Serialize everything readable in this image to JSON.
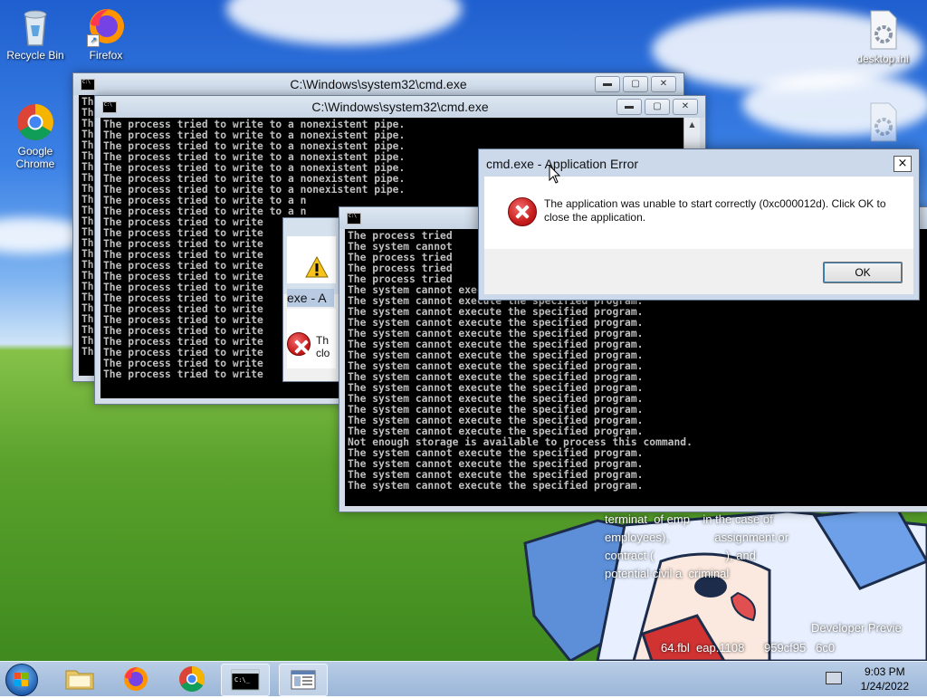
{
  "desktop": {
    "icons": [
      {
        "label": "Recycle Bin",
        "icon": "recycle-bin-icon"
      },
      {
        "label": "Firefox",
        "icon": "firefox-icon"
      },
      {
        "label": "Google Chrome",
        "icon": "chrome-icon"
      },
      {
        "label": "desktop.ini",
        "icon": "settings-file-icon"
      }
    ],
    "watermark_lines": [
      "terminat",
      "of emp",
      "in the case of",
      "employees),",
      "assignment or",
      "contract (",
      "), and",
      "potential civil a",
      "criminal",
      "Developer Previe",
      "64.fbl",
      "eap.1108",
      "959cf95",
      "6c0"
    ]
  },
  "windows": {
    "cmd_back": {
      "title": "C:\\Windows\\system32\\cmd.exe",
      "lines": "Th\nTh\nTh\nTh\nTh\nTh\nTh\nTh\nTh\nTh\nTh\nTh\nTh\nTh\nTh\nTh\nTh\nTh\nTh\nTh\nTh\nTh\nTh\nTh"
    },
    "cmd_front": {
      "title": "C:\\Windows\\system32\\cmd.exe",
      "lines": "The process tried to write to a nonexistent pipe.\nThe process tried to write to a nonexistent pipe.\nThe process tried to write to a nonexistent pipe.\nThe process tried to write to a nonexistent pipe.\nThe process tried to write to a nonexistent pipe.\nThe process tried to write to a nonexistent pipe.\nThe process tried to write to a nonexistent pipe.\nThe process tried to write to a n\nThe process tried to write to a n\nThe process tried to write\nThe process tried to write\nThe process tried to write\nThe process tried to write\nThe process tried to write\nThe process tried to write\nThe process tried to write\nThe process tried to write\nThe process tried to write\nThe process tried to write\nThe process tried to write\nThe process tried to write\nThe process tried to write\nThe process tried to write\nThe process tried to write"
    },
    "cmd_third": {
      "lines": "The process tried\nThe system cannot\nThe process tried\nThe process tried\nThe process tried\nThe system cannot execute the specified program.\nThe system cannot execute the specified program.\nThe system cannot execute the specified program.\nThe system cannot execute the specified program.\nThe system cannot execute the specified program.\nThe system cannot execute the specified program.\nThe system cannot execute the specified program.\nThe system cannot execute the specified program.\nThe system cannot execute the specified program.\nThe system cannot execute the specified program.\nThe system cannot execute the specified program.\nThe system cannot execute the specified program.\nThe system cannot execute the specified program.\nThe system cannot execute the specified program.\nNot enough storage is available to process this command.\nThe system cannot execute the specified program.\nThe system cannot execute the specified program.\nThe system cannot execute the specified program.\nThe system cannot execute the specified program."
    },
    "partial_dialog": {
      "title_fragment": "exe - A",
      "msg_line1": "Th",
      "msg_line2": "clo"
    }
  },
  "error_dialog": {
    "title": "cmd.exe - Application Error",
    "close_label": "×",
    "message": "The application was unable to start correctly (0xc000012d). Click OK to close the application.",
    "ok_label": "OK"
  },
  "window_buttons": {
    "minimize": "▬",
    "maximize": "▢",
    "close": "✕"
  },
  "taskbar": {
    "items": [
      {
        "name": "file-explorer",
        "icon": "folder-icon"
      },
      {
        "name": "firefox",
        "icon": "firefox-icon"
      },
      {
        "name": "chrome",
        "icon": "chrome-icon"
      },
      {
        "name": "cmd",
        "icon": "cmd-icon",
        "active": true
      },
      {
        "name": "app-window",
        "icon": "window-icon"
      }
    ],
    "clock_time": "9:03 PM",
    "clock_date": "1/24/2022"
  }
}
